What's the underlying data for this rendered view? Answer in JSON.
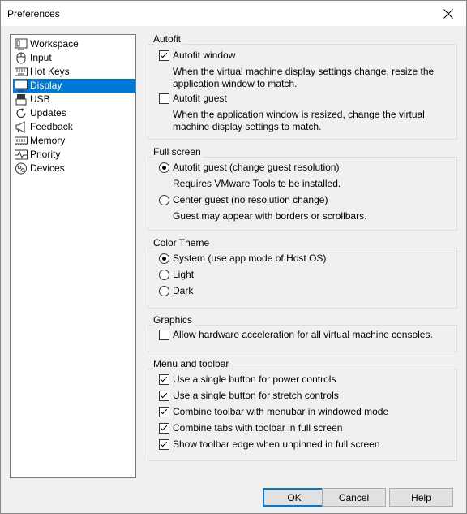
{
  "window": {
    "title": "Preferences"
  },
  "sidebar": {
    "items": [
      {
        "label": "Workspace",
        "icon": "workspace-icon"
      },
      {
        "label": "Input",
        "icon": "mouse-icon"
      },
      {
        "label": "Hot Keys",
        "icon": "keyboard-icon"
      },
      {
        "label": "Display",
        "icon": "monitor-icon",
        "selected": true
      },
      {
        "label": "USB",
        "icon": "usb-icon"
      },
      {
        "label": "Updates",
        "icon": "refresh-icon"
      },
      {
        "label": "Feedback",
        "icon": "megaphone-icon"
      },
      {
        "label": "Memory",
        "icon": "memory-icon"
      },
      {
        "label": "Priority",
        "icon": "pulse-icon"
      },
      {
        "label": "Devices",
        "icon": "devices-icon"
      }
    ],
    "selected_color": "#0078d7"
  },
  "autofit": {
    "title": "Autofit",
    "window_label": "Autofit window",
    "window_checked": true,
    "window_desc": "When the virtual machine display settings change, resize the application window to match.",
    "guest_label": "Autofit guest",
    "guest_checked": false,
    "guest_desc": "When the application window is resized, change the virtual machine display settings to match."
  },
  "fullscreen": {
    "title": "Full screen",
    "autofit_label": "Autofit guest (change guest resolution)",
    "autofit_desc": "Requires VMware Tools to be installed.",
    "center_label": "Center guest (no resolution change)",
    "center_desc": "Guest may appear with borders or scrollbars.",
    "selected": "autofit"
  },
  "theme": {
    "title": "Color Theme",
    "system_label": "System (use app mode of Host OS)",
    "light_label": "Light",
    "dark_label": "Dark",
    "selected": "system"
  },
  "graphics": {
    "title": "Graphics",
    "hw_accel_label": "Allow hardware acceleration for all virtual machine consoles.",
    "hw_accel_checked": false
  },
  "menu_toolbar": {
    "title": "Menu and toolbar",
    "items": [
      {
        "label": "Use a single button for power controls",
        "checked": true
      },
      {
        "label": "Use a single button for stretch controls",
        "checked": true
      },
      {
        "label": "Combine toolbar with menubar in windowed mode",
        "checked": true
      },
      {
        "label": "Combine tabs with toolbar in full screen",
        "checked": true
      },
      {
        "label": "Show toolbar edge when unpinned in full screen",
        "checked": true
      }
    ]
  },
  "buttons": {
    "ok": "OK",
    "cancel": "Cancel",
    "help": "Help"
  }
}
